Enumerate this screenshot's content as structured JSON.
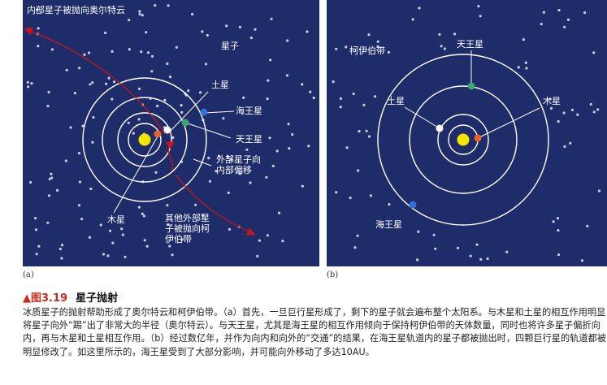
{
  "panel_a": {
    "top_label": "内部星子被抛向奥尔特云",
    "labels": {
      "planetesimals": "星子",
      "saturn": "土星",
      "neptune": "海王星",
      "uranus": "天王星",
      "migrate_inward": "外部星子向\n内部偏移",
      "jupiter": "木星",
      "kuiper": "其他外部星\n子被抛向柯\n伊伯带"
    },
    "sub_label": "(a)"
  },
  "panel_b": {
    "labels": {
      "kuiper_belt": "柯伊伯带",
      "uranus": "天王星",
      "saturn": "土星",
      "jupiter": "木星",
      "neptune": "海王星"
    },
    "sub_label": "(b)"
  },
  "colors": {
    "background": "#1f2c6a",
    "sun": "#f5e600",
    "jupiter": "#e8612a",
    "saturn": "#ffffff",
    "uranus": "#3aa86b",
    "neptune": "#2f6fd6",
    "trajectory": "#c4161c"
  },
  "caption": {
    "marker": "▲",
    "figure": "图3.19",
    "title": "星子抛射",
    "body": "冰质星子的抛射帮助形成了奥尔特云和柯伊伯带。（a）首先，一旦巨行星形成了，剩下的星子就会遍布整个太阳系。与木星和土星的相互作用明显将星子向外“踢”出了非常大的半径（奥尔特云）。与天王星，尤其是海王星的相互作用倾向于保持柯伊伯带的天体数量，同时也将许多星子偏折向内，再与木星和土星相互作用。（b）经过数亿年，并作为向内和向外的“交通”的结果，在海王星轨道内的星子都被抛出时，四颗巨行星的轨道都被明显修改了。如这里所示的，海王星受到了大部分影响，并可能向外移动了多达10AU。"
  }
}
